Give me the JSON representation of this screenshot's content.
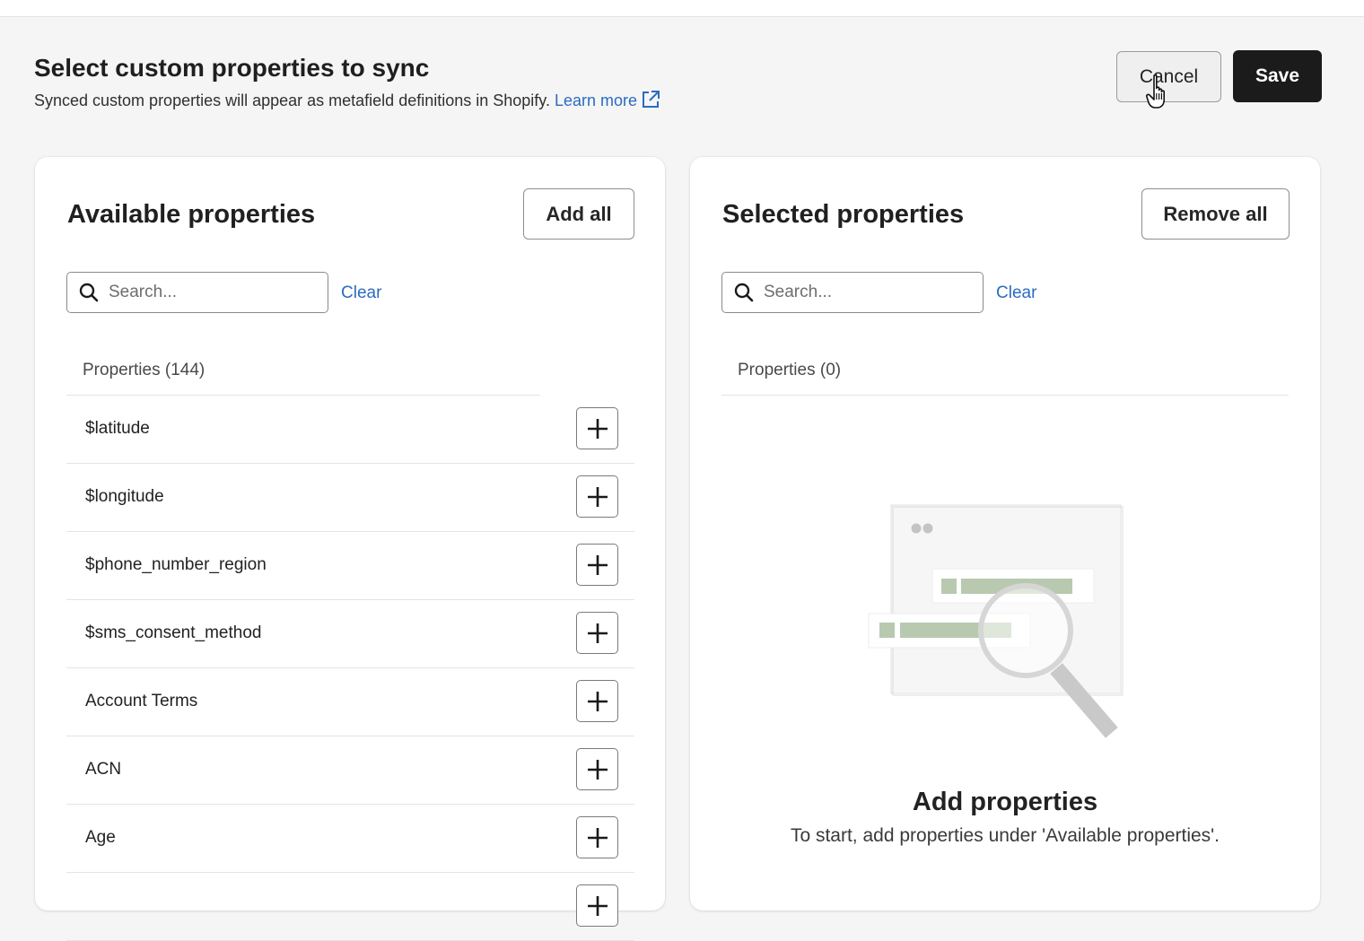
{
  "header": {
    "title": "Select custom properties to sync",
    "subtitle": "Synced custom properties will appear as metafield definitions in Shopify.",
    "learn_more": "Learn more",
    "cancel_label": "Cancel",
    "save_label": "Save"
  },
  "available": {
    "title": "Available properties",
    "add_all_label": "Add all",
    "search_placeholder": "Search...",
    "clear_label": "Clear",
    "count_label": "Properties (144)",
    "items": [
      {
        "name": "$latitude"
      },
      {
        "name": "$longitude"
      },
      {
        "name": "$phone_number_region"
      },
      {
        "name": "$sms_consent_method"
      },
      {
        "name": "Account Terms"
      },
      {
        "name": "ACN"
      },
      {
        "name": "Age"
      }
    ]
  },
  "selected": {
    "title": "Selected properties",
    "remove_all_label": "Remove all",
    "search_placeholder": "Search...",
    "clear_label": "Clear",
    "count_label": "Properties (0)",
    "empty_title": "Add properties",
    "empty_subtitle": "To start, add properties under 'Available properties'."
  },
  "colors": {
    "link": "#2b6bbf",
    "primary_button": "#1b1b1b",
    "illustration_green": "#b8c9b0"
  },
  "icons": [
    "search-icon",
    "external-link-icon",
    "plus-icon",
    "pointer-cursor-icon",
    "magnifier-illustration"
  ]
}
